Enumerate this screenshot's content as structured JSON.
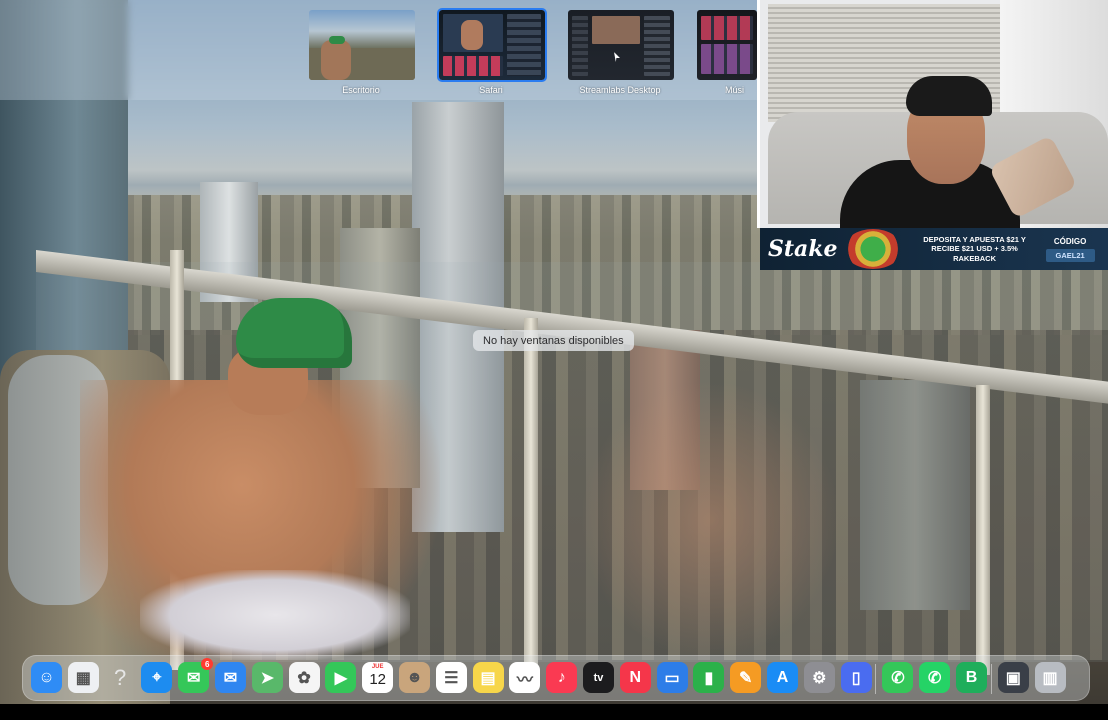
{
  "spaces": [
    {
      "label": "Escritorio",
      "selected": false
    },
    {
      "label": "Safari",
      "selected": true
    },
    {
      "label": "Streamlabs Desktop",
      "selected": false
    },
    {
      "label": "Músi",
      "selected": false
    }
  ],
  "empty_space_message": "No hay ventanas disponibles",
  "sponsor": {
    "brand": "Stake",
    "line1": "DEPOSITA Y APUESTA $21 Y",
    "line2": "RECIBE $21 USD + 3.5%",
    "line3": "RAKEBACK",
    "code_label": "CÓDIGO",
    "code_value": "GAEL21"
  },
  "dock": {
    "items": [
      {
        "name": "finder",
        "glyph": "☺",
        "color": "#2f8cf5"
      },
      {
        "name": "launchpad",
        "glyph": "▦",
        "color": "#eef0f3"
      },
      {
        "name": "help",
        "glyph": "?",
        "color": "transparent"
      },
      {
        "name": "safari",
        "glyph": "⌖",
        "color": "#1d8cf0"
      },
      {
        "name": "messages",
        "glyph": "✉",
        "color": "#35c759",
        "badge": "6"
      },
      {
        "name": "mail",
        "glyph": "✉",
        "color": "#2f86f0"
      },
      {
        "name": "maps",
        "glyph": "➤",
        "color": "#59b86a"
      },
      {
        "name": "photos",
        "glyph": "✿",
        "color": "#f5f5f5"
      },
      {
        "name": "facetime",
        "glyph": "▶",
        "color": "#34c759"
      },
      {
        "name": "calendar",
        "month": "JUE",
        "day": "12",
        "color": "#ffffff"
      },
      {
        "name": "contacts",
        "glyph": "☻",
        "color": "#c9a57c"
      },
      {
        "name": "reminders",
        "glyph": "☰",
        "color": "#ffffff"
      },
      {
        "name": "notes",
        "glyph": "▤",
        "color": "#f7d64a"
      },
      {
        "name": "freeform",
        "glyph": "〰",
        "color": "#ffffff"
      },
      {
        "name": "music",
        "glyph": "♪",
        "color": "#fa3a52"
      },
      {
        "name": "appletv",
        "glyph": "tv",
        "color": "#1c1c1e"
      },
      {
        "name": "news",
        "glyph": "N",
        "color": "#f5364a"
      },
      {
        "name": "keynote",
        "glyph": "▭",
        "color": "#2d7de8"
      },
      {
        "name": "numbers",
        "glyph": "▮",
        "color": "#2cb14a"
      },
      {
        "name": "pages",
        "glyph": "✎",
        "color": "#f59b23"
      },
      {
        "name": "appstore",
        "glyph": "A",
        "color": "#1a8cf5"
      },
      {
        "name": "settings",
        "glyph": "⚙",
        "color": "#8e8e93"
      },
      {
        "name": "iphone-mirroring",
        "glyph": "▯",
        "color": "#4a6cf0"
      },
      {
        "name": "phone",
        "glyph": "✆",
        "color": "#34c759"
      },
      {
        "name": "whatsapp",
        "glyph": "✆",
        "color": "#25d366"
      },
      {
        "name": "whatsapp-business",
        "glyph": "B",
        "color": "#1fae5b"
      },
      {
        "name": "streamlabs-thumb",
        "glyph": "▣",
        "color": "#3a3f48"
      },
      {
        "name": "trash",
        "glyph": "▥",
        "color": "#b8bcc2"
      }
    ]
  }
}
